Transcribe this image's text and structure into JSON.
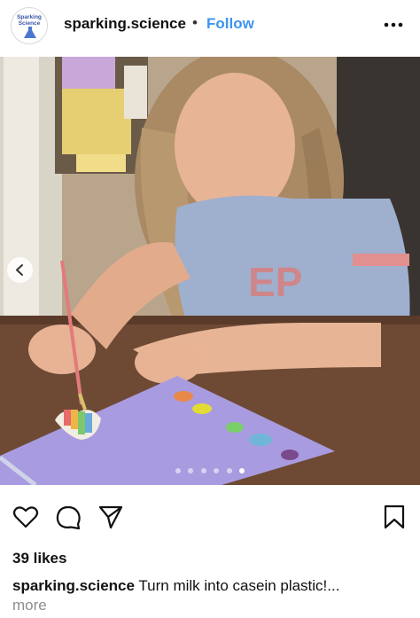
{
  "post": {
    "avatar_text": "Sparking Science",
    "username": "sparking.science",
    "separator": "•",
    "follow_label": "Follow",
    "more_icon": "more-horizontal-icon",
    "photo_alt": "Girl painting rainbow colors onto a casein plastic heart",
    "carousel": {
      "total": 6,
      "active_index": 5
    },
    "likes": "39 likes",
    "caption_user": "sparking.science",
    "caption_text": "Turn milk into casein plastic!...",
    "more_label": "more"
  },
  "actions": {
    "like_icon": "heart-icon",
    "comment_icon": "comment-icon",
    "share_icon": "send-icon",
    "save_icon": "bookmark-icon"
  },
  "colors": {
    "follow": "#3d95ef",
    "text": "#111111",
    "muted": "#8e8e8e",
    "paper": "#a99be0"
  }
}
